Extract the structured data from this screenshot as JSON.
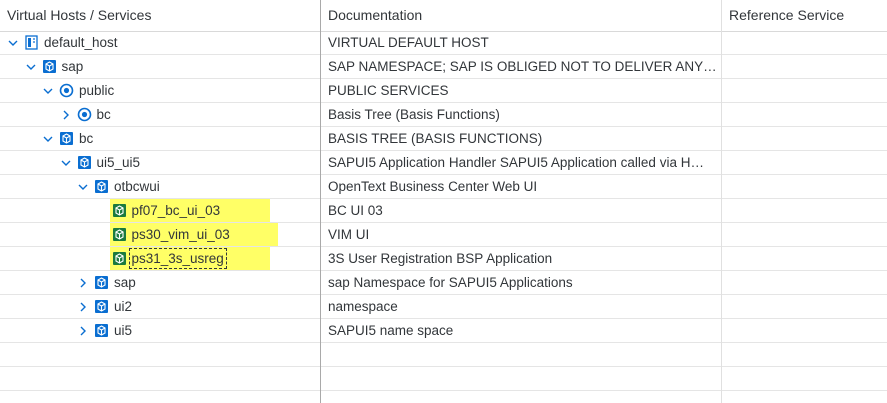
{
  "columns": {
    "col1": "Virtual Hosts / Services",
    "col2": "Documentation",
    "col3": "Reference Service"
  },
  "rows": [
    {
      "name": "default_host",
      "doc": "VIRTUAL DEFAULT HOST",
      "ref": "",
      "state": "expanded",
      "icon": "host-icon"
    },
    {
      "name": "sap",
      "doc": "SAP NAMESPACE; SAP IS OBLIGED NOT TO DELIVER ANY…",
      "ref": "",
      "state": "expanded",
      "icon": "service-node-icon"
    },
    {
      "name": "public",
      "doc": "PUBLIC SERVICES",
      "ref": "",
      "state": "expanded",
      "icon": "public-target-icon"
    },
    {
      "name": "bc",
      "doc": "Basis Tree (Basis Functions)",
      "ref": "",
      "state": "collapsed",
      "icon": "public-target-icon"
    },
    {
      "name": "bc",
      "doc": "BASIS TREE (BASIS FUNCTIONS)",
      "ref": "",
      "state": "expanded",
      "icon": "service-node-icon"
    },
    {
      "name": "ui5_ui5",
      "doc": "SAPUI5 Application Handler SAPUI5 Application called via H…",
      "ref": "",
      "state": "expanded",
      "icon": "service-node-icon"
    },
    {
      "name": "otbcwui",
      "doc": "OpenText Business Center Web UI",
      "ref": "",
      "state": "expanded",
      "icon": "service-node-icon"
    },
    {
      "name": "pf07_bc_ui_03",
      "doc": "BC UI 03",
      "ref": "",
      "state": "leaf",
      "icon": "service-leaf-icon"
    },
    {
      "name": "ps30_vim_ui_03",
      "doc": "VIM UI",
      "ref": "",
      "state": "leaf",
      "icon": "service-leaf-icon"
    },
    {
      "name": "ps31_3s_usreg",
      "doc": "3S User Registration BSP Application",
      "ref": "",
      "state": "leaf",
      "icon": "service-leaf-icon"
    },
    {
      "name": "sap",
      "doc": "sap Namespace for SAPUI5 Applications",
      "ref": "",
      "state": "collapsed",
      "icon": "service-node-icon"
    },
    {
      "name": "ui2",
      "doc": "namespace",
      "ref": "",
      "state": "collapsed",
      "icon": "service-node-icon"
    },
    {
      "name": "ui5",
      "doc": "SAPUI5 name space",
      "ref": "",
      "state": "collapsed",
      "icon": "service-node-icon"
    }
  ],
  "colors": {
    "highlight": "#ffff66",
    "icon_blue": "#0a6ed1",
    "toggle": "#0a6ed1"
  }
}
